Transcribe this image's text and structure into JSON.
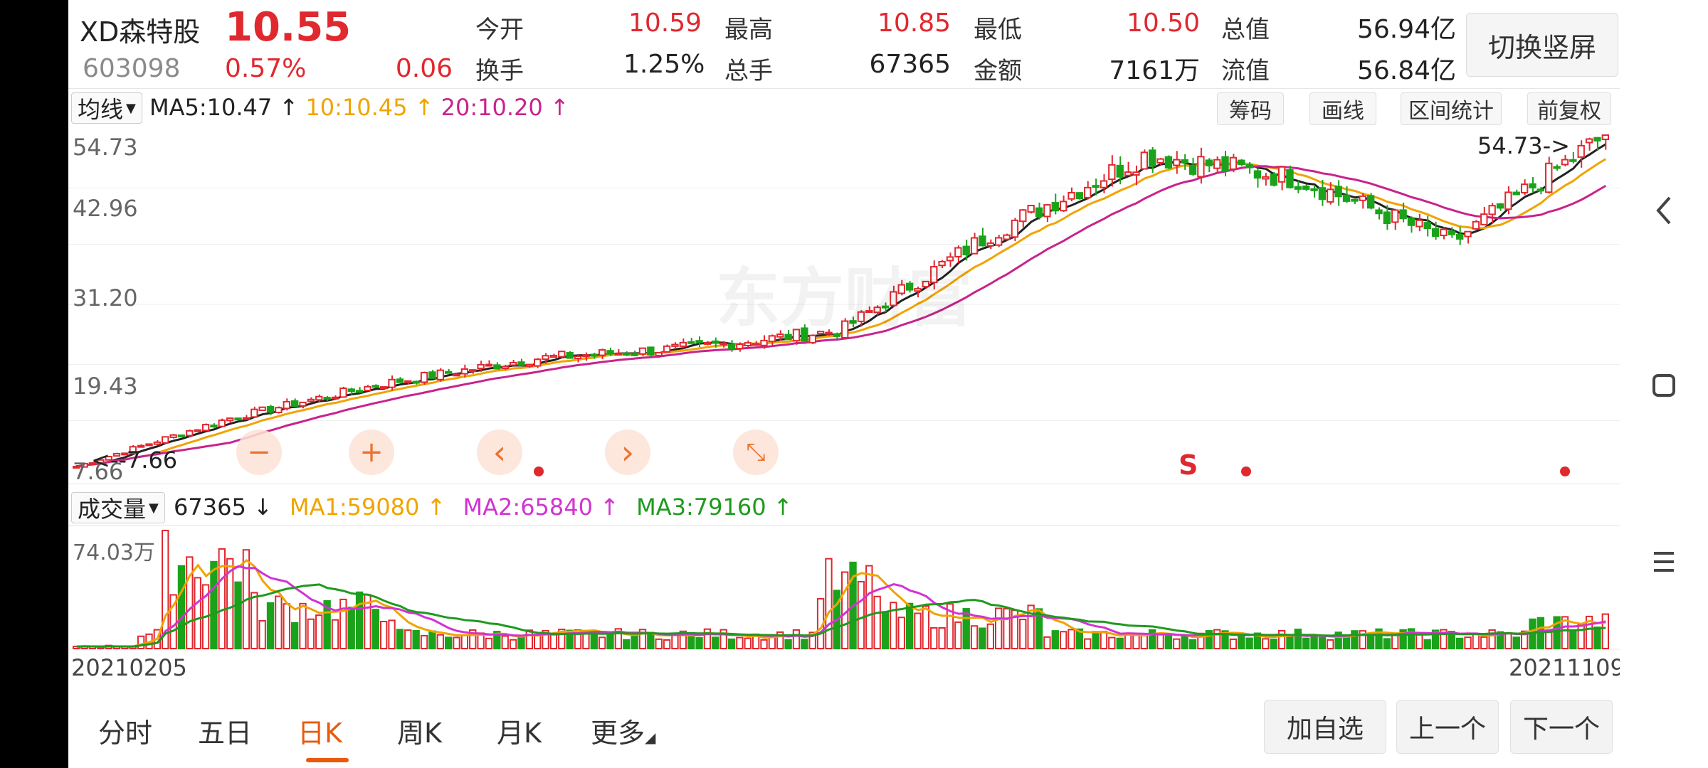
{
  "stock": {
    "name": "XD森特股",
    "price": "10.55",
    "code": "603098",
    "change_pct": "0.57%",
    "change": "0.06"
  },
  "quote": {
    "open_label": "今开",
    "open": "10.59",
    "high_label": "最高",
    "high": "10.85",
    "low_label": "最低",
    "low": "10.50",
    "total_value_label": "总值",
    "total_value": "56.94亿",
    "turnover_label": "换手",
    "turnover": "1.25%",
    "total_hands_label": "总手",
    "total_hands": "67365",
    "amount_label": "金额",
    "amount": "7161万",
    "float_value_label": "流值",
    "float_value": "56.84亿"
  },
  "switch_button": "切换竖屏",
  "price_toolbar": {
    "indicator": "均线",
    "ma5": "MA5:10.47",
    "ma10": "10:10.45",
    "ma20": "20:10.20",
    "arrow_up": "↑",
    "buttons": [
      "筹码",
      "画线",
      "区间统计",
      "前复权"
    ]
  },
  "price_chart": {
    "y_labels": [
      "54.73",
      "42.96",
      "31.20",
      "19.43",
      "7.66"
    ],
    "max_annotation": "54.73->",
    "min_annotation": "<--7.66",
    "watermark": "东方财富",
    "signal_s": "S",
    "zoom_controls": [
      "−",
      "+",
      "‹",
      "›",
      "⤡"
    ]
  },
  "volume_toolbar": {
    "indicator": "成交量",
    "value": "67365",
    "value_arrow": "↓",
    "ma1": "MA1:59080",
    "ma2": "MA2:65840",
    "ma3": "MA3:79160",
    "arrow_up": "↑"
  },
  "volume_chart": {
    "y_label": "74.03万"
  },
  "date_axis": {
    "start": "20210205",
    "end": "20211109"
  },
  "tabs": [
    "分时",
    "五日",
    "日K",
    "周K",
    "月K",
    "更多"
  ],
  "active_tab": "日K",
  "footer_buttons": [
    "加自选",
    "上一个",
    "下一个"
  ],
  "colors": {
    "up": "#e0282f",
    "down": "#1aa31a",
    "ma5": "#222222",
    "ma10": "#f0a400",
    "ma20": "#c8238c",
    "vol_ma1": "#f0a400",
    "vol_ma2": "#d233d2",
    "vol_ma3": "#1e9a1e",
    "accent": "#e85a0c"
  },
  "chart_data": {
    "type": "candlestick",
    "x_range": [
      "20210205",
      "20211109"
    ],
    "ylim": [
      7.66,
      54.73
    ],
    "price_trend": [
      {
        "date": "20210205",
        "close": 7.66
      },
      {
        "date": "20210308",
        "close": 14.5
      },
      {
        "date": "20210410",
        "close": 19.4
      },
      {
        "date": "20210510",
        "close": 23.0
      },
      {
        "date": "20210615",
        "close": 24.5
      },
      {
        "date": "20210715",
        "close": 27.0
      },
      {
        "date": "20210801",
        "close": 41.0
      },
      {
        "date": "20210825",
        "close": 52.0
      },
      {
        "date": "20210915",
        "close": 48.5
      },
      {
        "date": "20211010",
        "close": 39.5
      },
      {
        "date": "20211109",
        "close": 54.73
      }
    ],
    "volume_max": "74.03万"
  }
}
